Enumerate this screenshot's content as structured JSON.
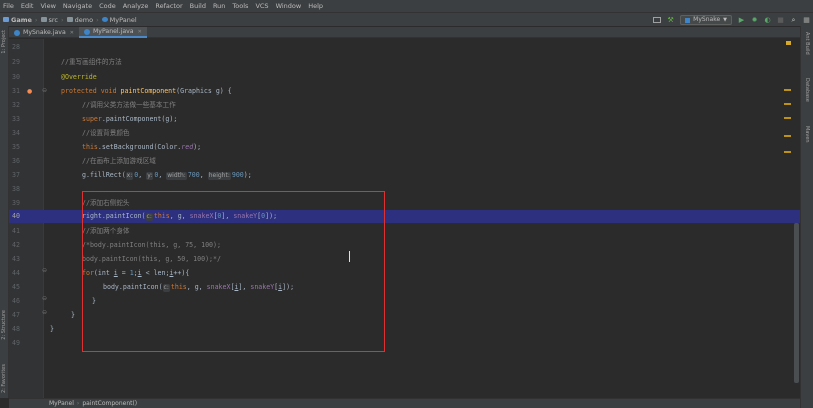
{
  "menu": [
    "File",
    "Edit",
    "View",
    "Navigate",
    "Code",
    "Analyze",
    "Refactor",
    "Build",
    "Run",
    "Tools",
    "VCS",
    "Window",
    "Help"
  ],
  "breadcrumbs": [
    "Game",
    "src",
    "demo",
    "MyPanel"
  ],
  "run_config": "MySnake",
  "tabs": [
    {
      "label": "MySnake.java",
      "active": false
    },
    {
      "label": "MyPanel.java",
      "active": true
    }
  ],
  "left_tools": [
    "1: Project",
    "2: Structure",
    "2: Favorites"
  ],
  "right_tools": [
    "Ant Build",
    "Database",
    "Maven"
  ],
  "line_numbers": [
    "28",
    "29",
    "30",
    "31",
    "32",
    "33",
    "34",
    "35",
    "36",
    "37",
    "38",
    "39",
    "40",
    "41",
    "42",
    "43",
    "44",
    "45",
    "46",
    "47",
    "48",
    "49"
  ],
  "current_line": "40",
  "code": {
    "l29": "//重写画组件的方法",
    "l30": "@Override",
    "l31_kw": "protected void ",
    "l31_fn": "paintComponent",
    "l31_rest": "(Graphics g) {",
    "l32": "//调用父类方法做一些基本工作",
    "l33_kw": "super",
    "l33_rest": ".paintComponent(g);",
    "l34": "//设置背景颜色",
    "l35_kw": "this",
    "l35_a": ".setBackground(Color.",
    "l35_it": "red",
    "l35_b": ");",
    "l36": "//在画布上添加游戏区域",
    "l37_a": "g.fillRect(",
    "l37_h1": "x:",
    "l37_n1": "0",
    "l37_h2": "y:",
    "l37_n2": "0",
    "l37_h3": "width:",
    "l37_n3": "700",
    "l37_h4": "height:",
    "l37_n4": "900",
    "l37_b": ");",
    "l39": "//添加右侧蛇头",
    "l40_a": "right.paintIcon(",
    "l40_h": "c:",
    "l40_kw": "this",
    "l40_b": ", g, ",
    "l40_f1": "snakeX",
    "l40_c": "[",
    "l40_n1": "0",
    "l40_d": "], ",
    "l40_f2": "snakeY",
    "l40_e": "[",
    "l40_n2": "0",
    "l40_f": "]);",
    "l41": "//添加两个身体",
    "l42": "/*body.paintIcon(this, g, 75, 100);",
    "l43": "body.paintIcon(this, g, 50, 100);*/",
    "l44_kw": "for",
    "l44_a": "(int ",
    "l44_i": "i",
    "l44_b": " = ",
    "l44_n": "1",
    "l44_c": ";",
    "l44_i2": "i",
    "l44_d": " < len;",
    "l44_i3": "i",
    "l44_e": "++){",
    "l45_a": "body.paintIcon(",
    "l45_h": "c:",
    "l45_kw": "this",
    "l45_b": ", g, ",
    "l45_f1": "snakeX",
    "l45_c": "[",
    "l45_i": "i",
    "l45_d": "], ",
    "l45_f2": "snakeY",
    "l45_e": "[",
    "l45_i2": "i",
    "l45_f": "]);",
    "l46": "}",
    "l47": "}",
    "l48": "}"
  },
  "status_crumbs": [
    "MyPanel",
    "paintComponent()"
  ],
  "colors": {
    "accent": "#4a88c7",
    "selection_box": "#e03131",
    "current_line": "#0b0ba0"
  }
}
